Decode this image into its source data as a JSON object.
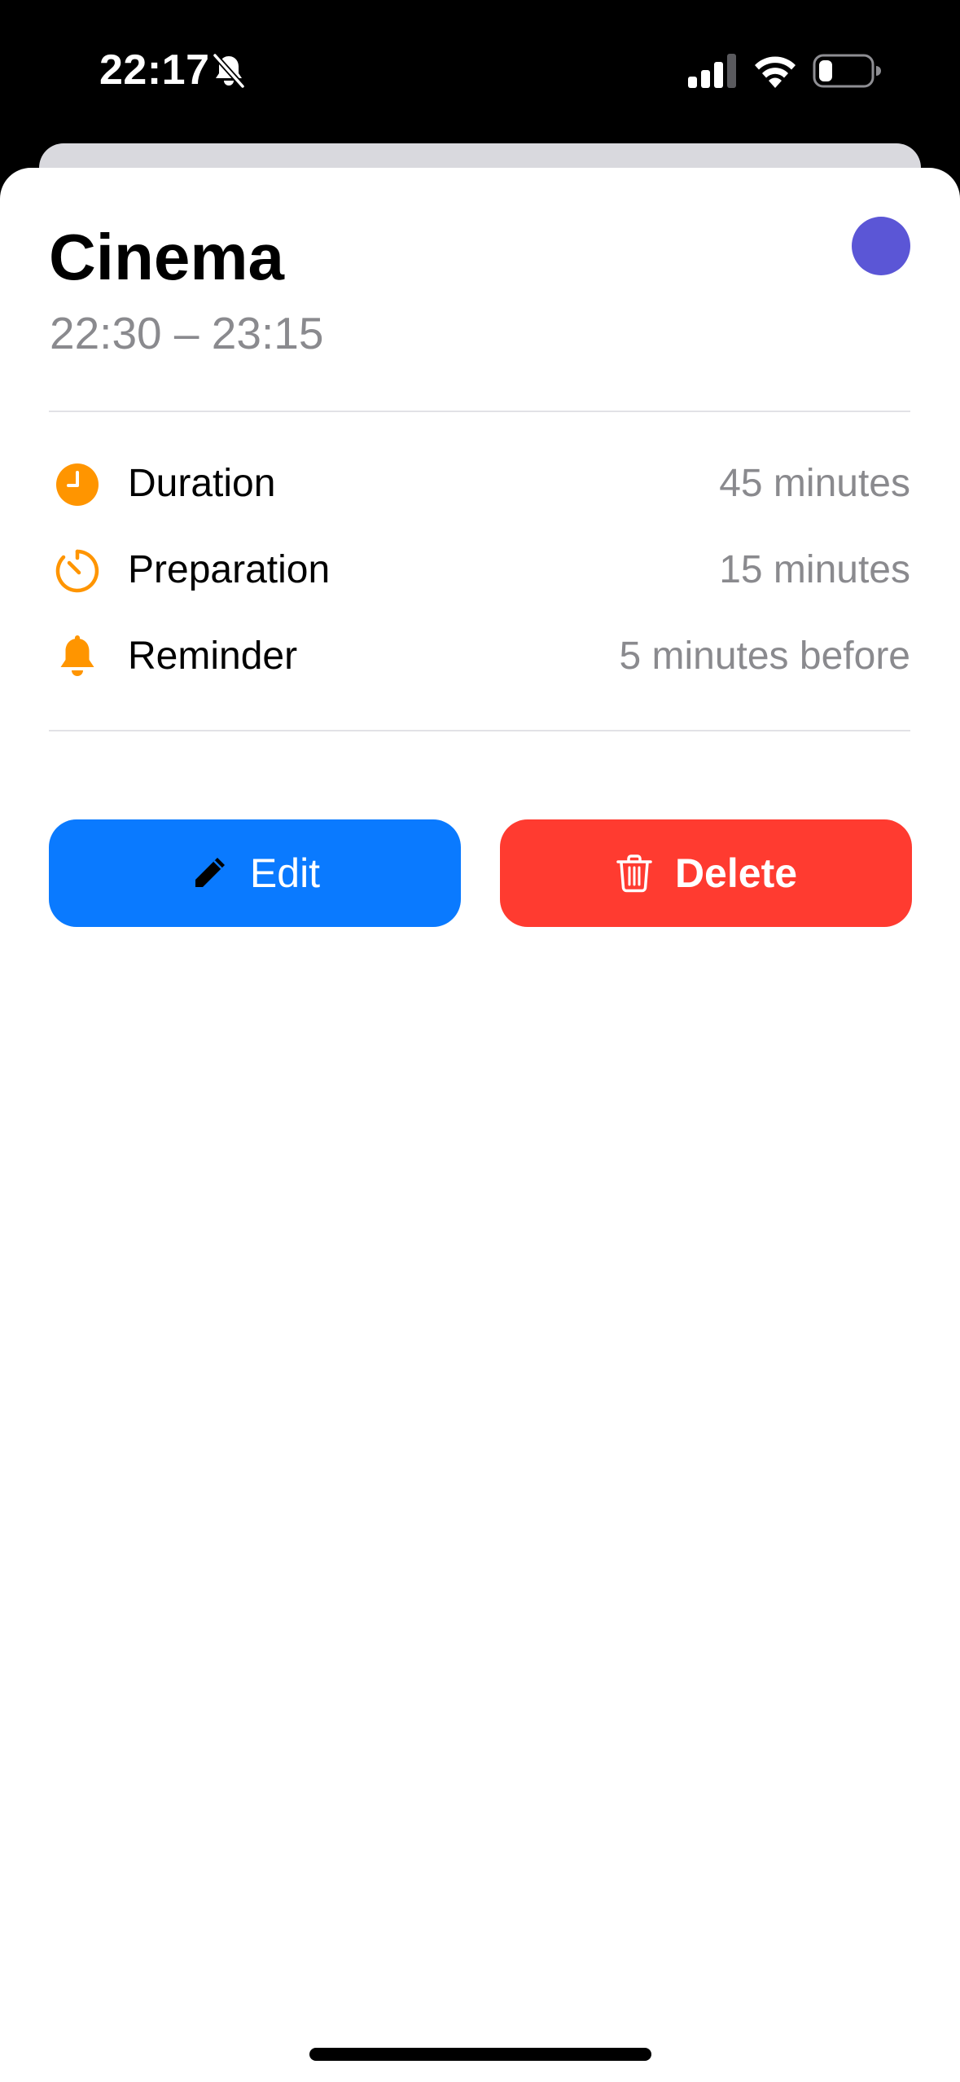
{
  "status_bar": {
    "time": "22:17",
    "icons": [
      "bell-slash-icon",
      "cellular-signal-icon",
      "wifi-icon",
      "battery-icon"
    ]
  },
  "event": {
    "title": "Cinema",
    "time_range": "22:30 – 23:15",
    "color": "#5b56d6"
  },
  "details": [
    {
      "icon": "clock-icon",
      "label": "Duration",
      "value": "45 minutes"
    },
    {
      "icon": "timer-icon",
      "label": "Preparation",
      "value": "15 minutes"
    },
    {
      "icon": "bell-icon",
      "label": "Reminder",
      "value": "5 minutes before"
    }
  ],
  "actions": {
    "edit_label": "Edit",
    "delete_label": "Delete"
  },
  "colors": {
    "accent_icon": "#ff9500",
    "edit_button": "#0a7aff",
    "delete_button": "#ff3b30",
    "secondary_text": "#8a8a8e"
  }
}
